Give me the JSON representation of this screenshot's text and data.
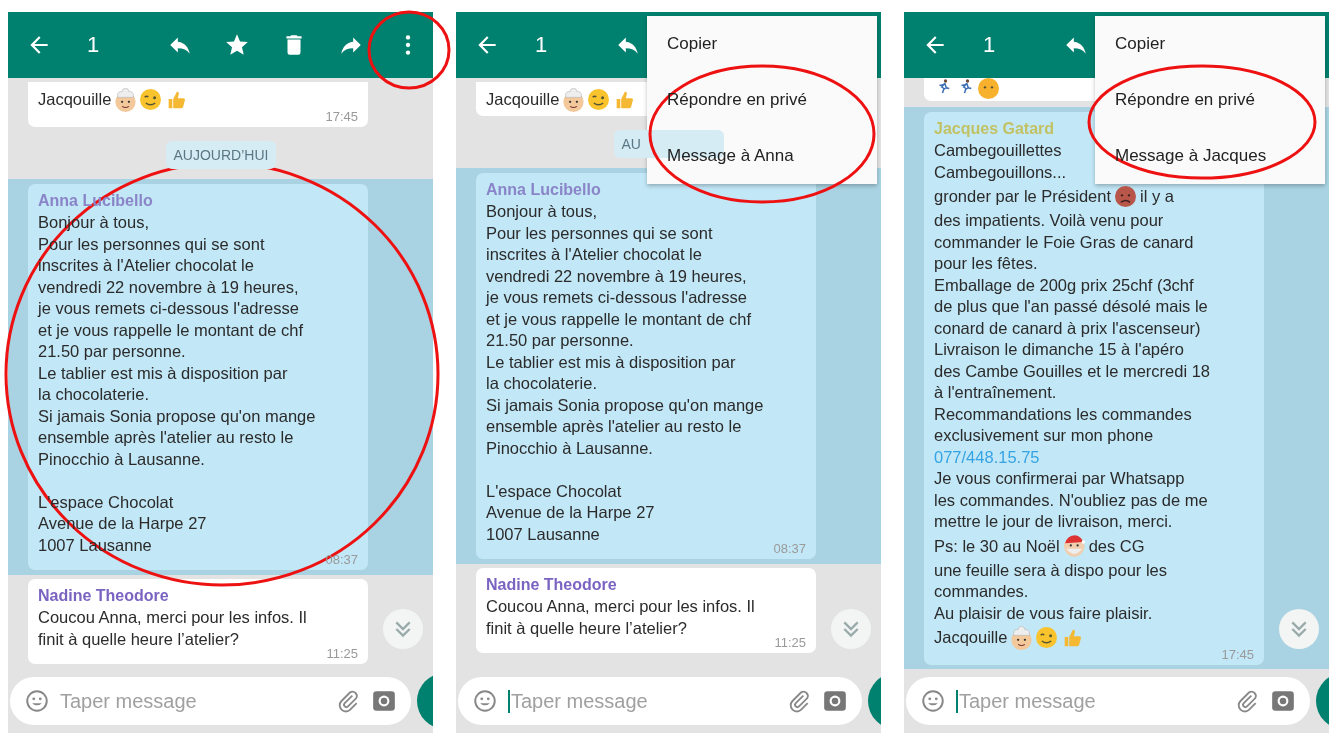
{
  "panels": [
    {
      "header": {
        "count": "1"
      },
      "chat": [
        {
          "kind": "message",
          "selected": false,
          "body": [
            {
              "kind": "signature",
              "text": "Jacqouille"
            }
          ],
          "time": "17:45"
        },
        {
          "kind": "date",
          "text": "AUJOURD’HUI"
        },
        {
          "kind": "message",
          "selected": true,
          "sender": "Anna Lucibello",
          "color": "#8a84c8",
          "body": [
            {
              "kind": "text",
              "text": "Bonjour à tous,\nPour les personnes qui se sont\ninscrites à l'Atelier chocolat le\nvendredi 22 novembre à 19 heures,\nje vous remets ci-dessous l'adresse\net je vous rappelle le montant de chf\n21.50 par personne.\nLe tablier est mis à disposition par\nla chocolaterie.\nSi jamais Sonia propose qu'on mange\nensemble après l'atelier au resto le\nPinocchio à Lausanne."
            },
            {
              "kind": "text",
              "text": "L'espace Chocolat\nAvenue de la Harpe 27\n1007 Lausanne"
            }
          ],
          "time": "08:37"
        },
        {
          "kind": "message",
          "selected": false,
          "sender": "Nadine Theodore",
          "color": "#7b63c2",
          "body": [
            {
              "kind": "text",
              "text": "Coucou Anna, merci pour les infos. Il\nfinit à quelle heure l’atelier?"
            }
          ],
          "time": "11:25"
        }
      ],
      "input": {
        "placeholder": "Taper message",
        "focused": false
      }
    },
    {
      "header": {
        "count": "1"
      },
      "menu": {
        "items": [
          "Copier",
          "Répondre en privé",
          "Message à Anna"
        ]
      },
      "chat": [
        {
          "kind": "message",
          "selected": false,
          "body": [
            {
              "kind": "signature",
              "text": "Jacqouille"
            }
          ]
        },
        {
          "kind": "date",
          "text": "AU"
        },
        {
          "kind": "message",
          "selected": true,
          "sender": "Anna Lucibello",
          "color": "#8a84c8",
          "body": [
            {
              "kind": "text",
              "text": "Bonjour à tous,\nPour les personnes qui se sont\ninscrites à l'Atelier chocolat le\nvendredi 22 novembre à 19 heures,\nje vous remets ci-dessous l'adresse\net je vous rappelle le montant de chf\n21.50 par personne.\nLe tablier est mis à disposition par\nla chocolaterie.\nSi jamais Sonia propose qu'on mange\nensemble après l'atelier au resto le\nPinocchio à Lausanne."
            },
            {
              "kind": "text",
              "text": "L'espace Chocolat\nAvenue de la Harpe 27\n1007 Lausanne"
            }
          ],
          "time": "08:37"
        },
        {
          "kind": "message",
          "selected": false,
          "sender": "Nadine Theodore",
          "color": "#7b63c2",
          "body": [
            {
              "kind": "text",
              "text": "Coucou Anna, merci pour les infos. Il\nfinit à quelle heure l’atelier?"
            }
          ],
          "time": "11:25"
        }
      ],
      "input": {
        "placeholder": "Taper message",
        "focused": true
      }
    },
    {
      "header": {
        "count": "1"
      },
      "menu": {
        "items": [
          "Copier",
          "Répondre en privé",
          "Message à Jacques"
        ]
      },
      "chat": [
        {
          "kind": "emoji_strip"
        },
        {
          "kind": "message",
          "selected": true,
          "sender": "Jacques Gatard",
          "color": "#c2c265",
          "body": [
            {
              "kind": "text",
              "text": "Cambegouillettes\nCambegouillons..."
            },
            {
              "kind": "split_frown",
              "parts": [
                "gronder par le Président",
                "il y a"
              ]
            },
            {
              "kind": "text",
              "text": "des impatients. Voilà venu pour\ncommander le Foie Gras de canard\npour les fêtes.\nEmballage de 200g prix 25chf (3chf\nde plus que l'an passé désolé mais le\nconard de canard à prix l'ascenseur)\nLivraison le dimanche 15 à l'apéro\ndes Cambe Gouilles et le mercredi 18\nà l'entraînement.\nRecommandations les commandes\nexclusivement sur mon phone"
            },
            {
              "kind": "link",
              "text": "077/448.15.75"
            },
            {
              "kind": "text",
              "text": "Je vous confirmerai par Whatsapp\nles commandes. N'oubliez pas de me\nmettre le jour de livraison, merci."
            },
            {
              "kind": "split_santa",
              "parts": [
                "Ps: le 30 au Noël",
                "des CG"
              ]
            },
            {
              "kind": "text",
              "text": "une feuille sera à dispo pour les\ncommandes.\nAu plaisir de vous faire plaisir."
            },
            {
              "kind": "signature",
              "text": "Jacqouille"
            }
          ],
          "time": "17:45"
        }
      ],
      "input": {
        "placeholder": "Taper message",
        "focused": true
      }
    }
  ]
}
